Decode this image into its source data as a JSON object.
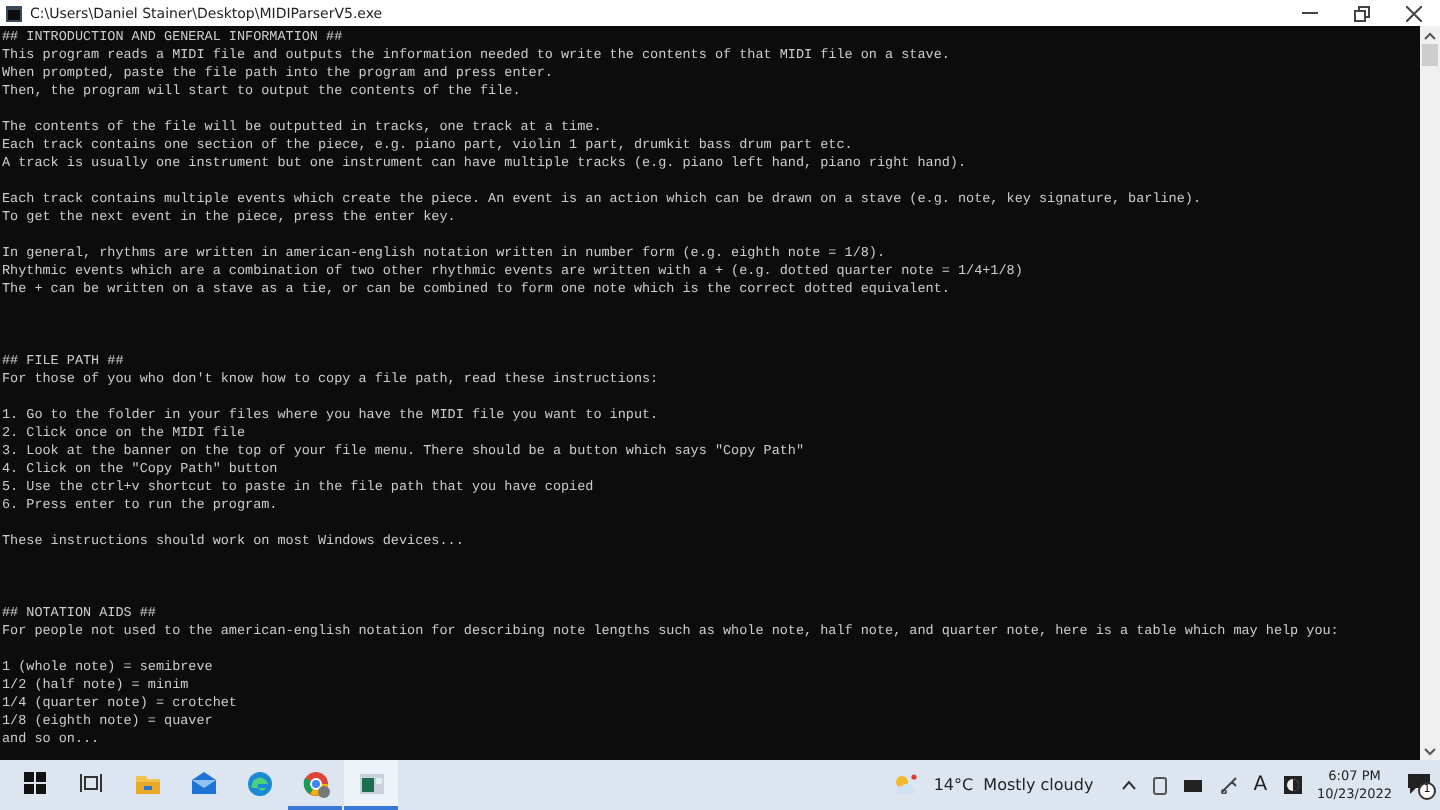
{
  "window": {
    "title": "C:\\Users\\Daniel Stainer\\Desktop\\MIDIParserV5.exe"
  },
  "console": {
    "sections": [
      {
        "paragraphs": [
          [
            "## INTRODUCTION AND GENERAL INFORMATION ##",
            "This program reads a MIDI file and outputs the information needed to write the contents of that MIDI file on a stave.",
            "When prompted, paste the file path into the program and press enter.",
            "Then, the program will start to output the contents of the file."
          ],
          [
            "The contents of the file will be outputted in tracks, one track at a time.",
            "Each track contains one section of the piece, e.g. piano part, violin 1 part, drumkit bass drum part etc.",
            "A track is usually one instrument but one instrument can have multiple tracks (e.g. piano left hand, piano right hand)."
          ],
          [
            "Each track contains multiple events which create the piece. An event is an action which can be drawn on a stave (e.g. note, key signature, barline).",
            "To get the next event in the piece, press the enter key."
          ],
          [
            "In general, rhythms are written in american-english notation written in number form (e.g. eighth note = 1/8).",
            "Rhythmic events which are a combination of two other rhythmic events are written with a + (e.g. dotted quarter note = 1/4+1/8)",
            "The + can be written on a stave as a tie, or can be combined to form one note which is the correct dotted equivalent."
          ]
        ]
      },
      {
        "paragraphs": [
          [
            "## FILE PATH ##",
            "For those of you who don't know how to copy a file path, read these instructions:"
          ],
          [
            "1. Go to the folder in your files where you have the MIDI file you want to input.",
            "2. Click once on the MIDI file",
            "3. Look at the banner on the top of your file menu. There should be a button which says \"Copy Path\"",
            "4. Click on the \"Copy Path\" button",
            "5. Use the ctrl+v shortcut to paste in the file path that you have copied",
            "6. Press enter to run the program."
          ],
          [
            "These instructions should work on most Windows devices..."
          ]
        ]
      },
      {
        "paragraphs": [
          [
            "## NOTATION AIDS ##",
            "For people not used to the american-english notation for describing note lengths such as whole note, half note, and quarter note, here is a table which may help you:"
          ],
          [
            "1 (whole note) = semibreve",
            "1/2 (half note) = minim",
            "1/4 (quarter note) = crotchet",
            "1/8 (eighth note) = quaver",
            "and so on..."
          ]
        ]
      }
    ]
  },
  "taskbar": {
    "apps": [
      {
        "kind": "start",
        "running": false,
        "selected": false
      },
      {
        "kind": "taskview",
        "running": false,
        "selected": false
      },
      {
        "kind": "explorer",
        "running": false,
        "selected": false
      },
      {
        "kind": "mail",
        "running": false,
        "selected": false
      },
      {
        "kind": "edge",
        "running": false,
        "selected": false
      },
      {
        "kind": "chrome",
        "running": true,
        "selected": false
      },
      {
        "kind": "console",
        "running": true,
        "selected": true
      }
    ],
    "weather": "14°C  Mostly cloudy",
    "language": "A",
    "time": "6:07 PM",
    "date": "10/23/2022",
    "notifications": "1"
  }
}
